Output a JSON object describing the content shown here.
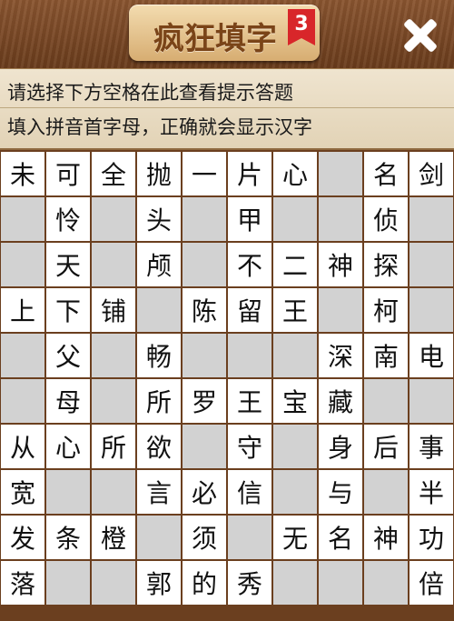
{
  "header": {
    "title": "疯狂填字",
    "level": "3",
    "close_icon": "close-icon"
  },
  "hints": {
    "line1": "请选择下方空格在此查看提示答题",
    "line2": "填入拼音首字母，正确就会显示汉字"
  },
  "grid": {
    "rows": [
      [
        "未",
        "可",
        "全",
        "抛",
        "一",
        "片",
        "心",
        "",
        "名",
        "剑"
      ],
      [
        "",
        "怜",
        "",
        "头",
        "",
        "甲",
        "",
        "",
        "侦",
        ""
      ],
      [
        "",
        "天",
        "",
        "颅",
        "",
        "不",
        "二",
        "神",
        "探",
        ""
      ],
      [
        "上",
        "下",
        "铺",
        "",
        "陈",
        "留",
        "王",
        "",
        "柯",
        ""
      ],
      [
        "",
        "父",
        "",
        "畅",
        "",
        "",
        "",
        "深",
        "南",
        "电"
      ],
      [
        "",
        "母",
        "",
        "所",
        "罗",
        "王",
        "宝",
        "藏",
        "",
        ""
      ],
      [
        "从",
        "心",
        "所",
        "欲",
        "",
        "守",
        "",
        "身",
        "后",
        "事"
      ],
      [
        "宽",
        "",
        "",
        "言",
        "必",
        "信",
        "",
        "与",
        "",
        "半"
      ],
      [
        "发",
        "条",
        "橙",
        "",
        "须",
        "",
        "无",
        "名",
        "神",
        "功"
      ],
      [
        "落",
        "",
        "",
        "郭",
        "的",
        "秀",
        "",
        "",
        "",
        "倍"
      ]
    ]
  }
}
